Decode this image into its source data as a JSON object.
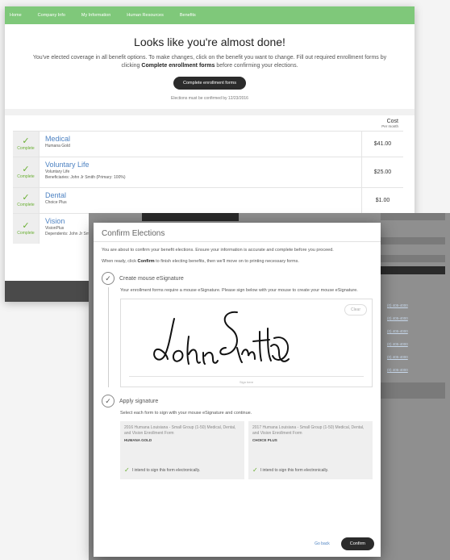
{
  "nav": {
    "items": [
      "Home",
      "Company Info",
      "My Information",
      "Human Resources",
      "Benefits"
    ]
  },
  "hero": {
    "title": "Looks like you're almost done!",
    "desc_before": "You've elected coverage in all benefit options. To make changes, click on the benefit you want to change. Fill out required enrollment forms by clicking ",
    "desc_bold": "Complete enrollment forms",
    "desc_after": " before confirming your elections.",
    "cta_label": "Complete enrollment forms",
    "deadline": "Elections must be confirmed by 12/23/2016"
  },
  "table": {
    "cost_header": "Cost",
    "cost_sub": "Per month",
    "rows": [
      {
        "status": "Complete",
        "title": "Medical",
        "subtitle": "Humana Gold",
        "beneficiaries": "",
        "price": "$41.00"
      },
      {
        "status": "Complete",
        "title": "Voluntary Life",
        "subtitle": "Voluntary Life",
        "beneficiaries": "Beneficiaries: John Jr Smith (Primary: 100%)",
        "price": "$25.00"
      },
      {
        "status": "Complete",
        "title": "Dental",
        "subtitle": "Choice Plus",
        "beneficiaries": "",
        "price": "$1.00"
      },
      {
        "status": "Complete",
        "title": "Vision",
        "subtitle": "VisionPlus",
        "beneficiaries": "Dependents: John Jr Smith",
        "price": ""
      }
    ]
  },
  "modal": {
    "title": "Confirm Elections",
    "intro": "You are about to confirm your benefit elections. Ensure your information is accurate and complete before you proceed.",
    "ready_before": "When ready, click ",
    "ready_bold": "Confirm",
    "ready_after": " to finish electing benefits, then we'll move on to printing necessary forms.",
    "step1": {
      "title": "Create mouse eSignature",
      "desc": "Your enrollment forms require a mouse eSignature. Please sign below with your mouse to create your mouse eSignature.",
      "clear_label": "Clear",
      "caption": "Sign here"
    },
    "step2": {
      "title": "Apply signature",
      "desc": "Select each form to sign with your mouse eSignature and continue.",
      "forms": [
        {
          "title": "2016 Humana Louisiana - Small Group (1-50) Medical, Dental, and Vision Enrollment Form",
          "plan": "HUMANA GOLD",
          "consent": "I intend to sign this form electronically."
        },
        {
          "title": "2017 Humana Louisiana - Small Group (1-50) Medical, Dental, and Vision Enrollment Form",
          "plan": "CHOICE PLUS",
          "consent": "I intend to sign this form electronically."
        }
      ]
    },
    "go_back": "Go back",
    "confirm": "Confirm"
  },
  "background_form": {
    "links": [
      "(0) 405-4000",
      "(0) 405-4000",
      "(0) 405-4000",
      "(0) 405-4000",
      "(0) 405-4000",
      "(0) 405-4000"
    ]
  },
  "colors": {
    "nav_green": "#7fc87a",
    "link_blue": "#4d82c2",
    "check_green": "#6aaf33",
    "dark_button": "#2b2b2b"
  }
}
